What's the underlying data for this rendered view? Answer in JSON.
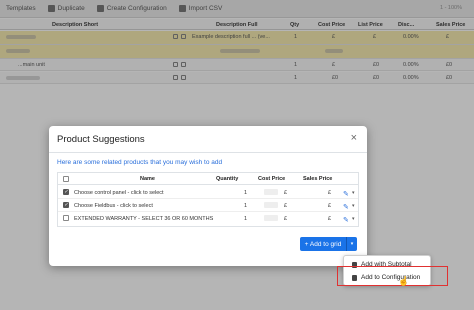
{
  "toolbar": {
    "items": [
      {
        "label": "Templates"
      },
      {
        "label": "Duplicate"
      },
      {
        "label": "Create Configuration"
      },
      {
        "label": "Import CSV"
      }
    ],
    "pager": "1 - 100%"
  },
  "grid": {
    "headers": [
      "Description Short",
      "Description Full",
      "Qty",
      "Cost Price",
      "List Price",
      "Disc...",
      "Sales Price"
    ],
    "rows": [
      {
        "desc_full": "Example description full ... (ve...",
        "qty": "1",
        "cost": "£",
        "list": "£",
        "disc": "0.00%",
        "sales": "£"
      },
      {
        "desc_short": "...main unit",
        "qty": "1",
        "cost": "£",
        "list": "£0",
        "disc": "0.00%",
        "sales": "£0"
      },
      {
        "qty": "1",
        "cost": "£0",
        "list": "£0",
        "disc": "0.00%",
        "sales": "£0"
      }
    ]
  },
  "modal": {
    "title": "Product Suggestions",
    "close_glyph": "×",
    "intro": "Here are some related products that you may wish to add",
    "columns": {
      "name": "Name",
      "quantity": "Quantity",
      "cost": "Cost Price",
      "sales": "Sales Price"
    },
    "rows": [
      {
        "name": "Choose control panel - click to select",
        "quantity": "1",
        "cost": "£",
        "sales": "£",
        "checked": true
      },
      {
        "name": "Choose Fieldbus - click to select",
        "quantity": "1",
        "cost": "£",
        "sales": "£",
        "checked": true
      },
      {
        "name": "EXTENDED WARRANTY - SELECT 36 OR 60 MONTHS",
        "quantity": "1",
        "cost": "£",
        "sales": "£",
        "checked": false
      }
    ],
    "add_button": "+ Add to grid",
    "caret_glyph": "▾"
  },
  "menu": {
    "items": [
      {
        "label": "Add with Subtotal"
      },
      {
        "label": "Add to Configuration"
      }
    ]
  },
  "colors": {
    "accent": "#1a73e8",
    "highlight_row": "#f5e9a6",
    "annotation": "#e03131"
  },
  "icons": [
    "templates-icon",
    "duplicate-icon",
    "create-configuration-icon",
    "import-csv-icon",
    "close-icon",
    "edit-pencil-icon",
    "save-icon"
  ]
}
